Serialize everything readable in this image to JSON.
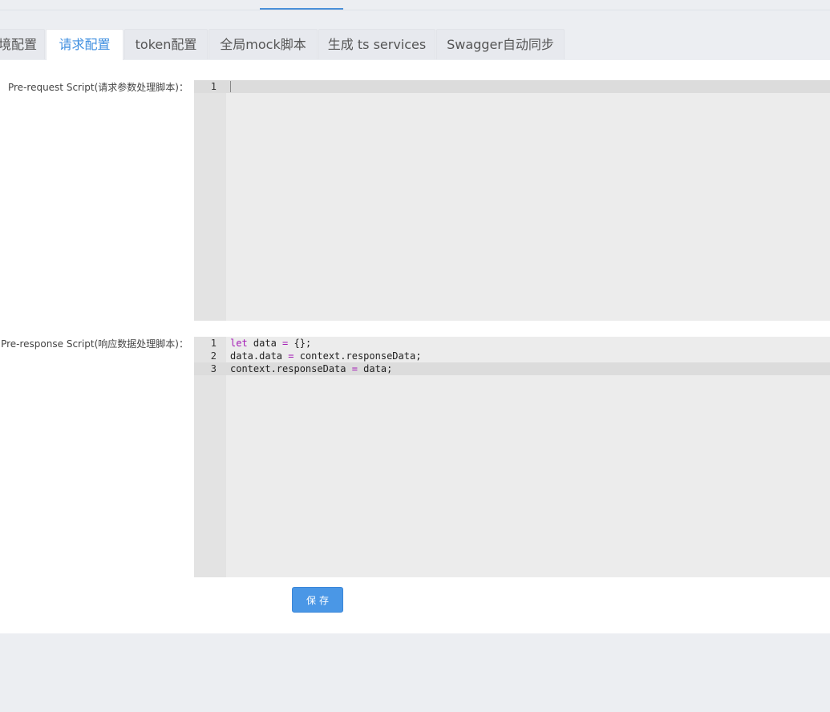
{
  "tabs": [
    {
      "label": "境配置",
      "active": false
    },
    {
      "label": "请求配置",
      "active": true
    },
    {
      "label": "token配置",
      "active": false
    },
    {
      "label": "全局mock脚本",
      "active": false
    },
    {
      "label": "生成 ts services",
      "active": false
    },
    {
      "label": "Swagger自动同步",
      "active": false
    }
  ],
  "form": {
    "pre_request_label": "Pre-request Script(请求参数处理脚本)：",
    "pre_response_label": "Pre-response Script(响应数据处理脚本)：",
    "pre_request_lines": [
      {
        "number": "1",
        "code": ""
      }
    ],
    "pre_response_lines": [
      {
        "number": "1",
        "kw": "let",
        "name": " data ",
        "op": "=",
        "rest": " {};"
      },
      {
        "number": "2",
        "pre": "data.data ",
        "op": "=",
        "rest": " context.responseData;"
      },
      {
        "number": "3",
        "pre": "context.responseData ",
        "op": "=",
        "rest": " data;"
      }
    ],
    "save_label": "保存"
  },
  "colors": {
    "accent": "#3d8ee0",
    "button": "#4a97e6",
    "keyword": "#a41bb6"
  }
}
